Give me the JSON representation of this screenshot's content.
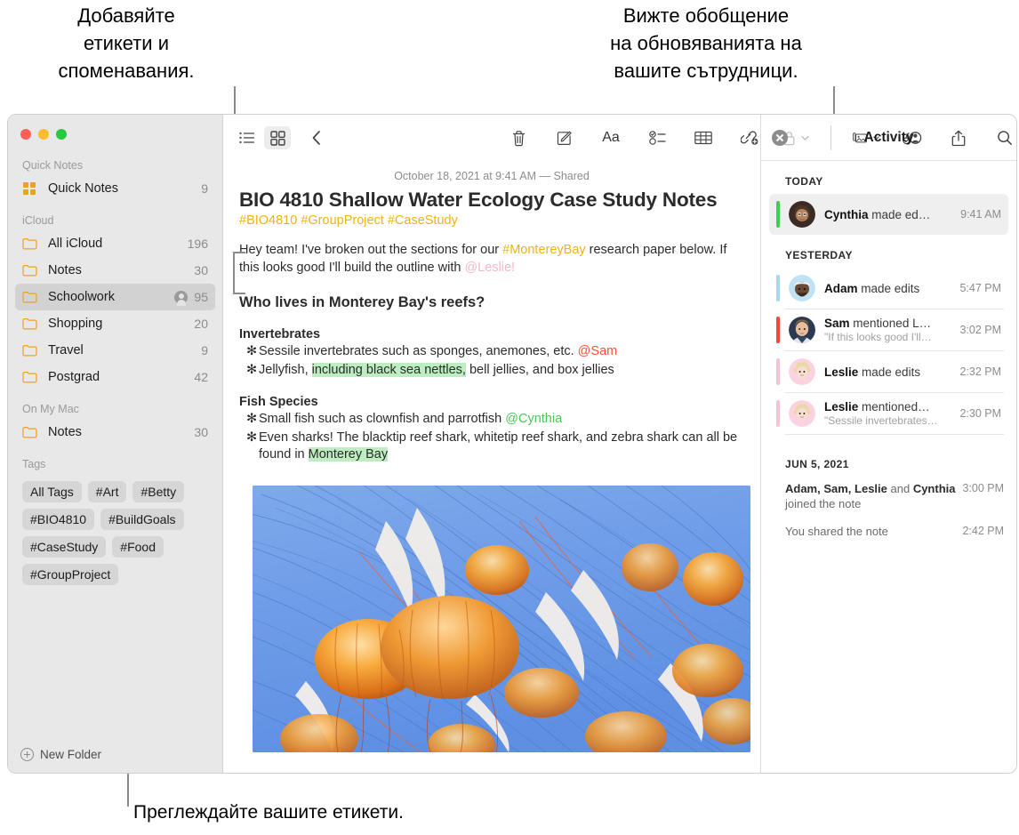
{
  "callouts": {
    "left": "Добавяйте\nетикети и\nспоменавания.",
    "right": "Вижте обобщение\nна обновяванията на\nвашите сътрудници.",
    "bottom": "Преглеждайте вашите етикети."
  },
  "window": {
    "traffic_lights": [
      "close",
      "minimize",
      "zoom"
    ]
  },
  "sidebar": {
    "groups": [
      {
        "title": "Quick Notes",
        "rows": [
          {
            "icon": "quicknotes-icon",
            "label": "Quick Notes",
            "count": "9",
            "shared": false,
            "selected": false
          }
        ]
      },
      {
        "title": "iCloud",
        "rows": [
          {
            "icon": "folder-icon",
            "label": "All iCloud",
            "count": "196",
            "shared": false,
            "selected": false
          },
          {
            "icon": "folder-icon",
            "label": "Notes",
            "count": "30",
            "shared": false,
            "selected": false
          },
          {
            "icon": "folder-icon",
            "label": "Schoolwork",
            "count": "95",
            "shared": true,
            "selected": true
          },
          {
            "icon": "folder-icon",
            "label": "Shopping",
            "count": "20",
            "shared": false,
            "selected": false
          },
          {
            "icon": "folder-icon",
            "label": "Travel",
            "count": "9",
            "shared": false,
            "selected": false
          },
          {
            "icon": "folder-icon",
            "label": "Postgrad",
            "count": "42",
            "shared": false,
            "selected": false
          }
        ]
      },
      {
        "title": "On My Mac",
        "rows": [
          {
            "icon": "folder-icon",
            "label": "Notes",
            "count": "30",
            "shared": false,
            "selected": false
          }
        ]
      }
    ],
    "tags_title": "Tags",
    "tags": [
      "All Tags",
      "#Art",
      "#Betty",
      "#BIO4810",
      "#BuildGoals",
      "#CaseStudy",
      "#Food",
      "#GroupProject"
    ],
    "new_folder_label": "New Folder"
  },
  "toolbar": {
    "buttons": [
      {
        "name": "list-view-icon",
        "label": "List View"
      },
      {
        "name": "gallery-view-icon",
        "label": "Gallery View"
      },
      {
        "name": "back-chevron-icon",
        "label": "Back"
      },
      {
        "name": "trash-icon",
        "label": "Delete"
      },
      {
        "name": "compose-icon",
        "label": "New Note"
      },
      {
        "name": "format-icon",
        "label": "Aa"
      },
      {
        "name": "checklist-icon",
        "label": "Checklist"
      },
      {
        "name": "table-icon",
        "label": "Table"
      },
      {
        "name": "link-icon",
        "label": "Add Link"
      },
      {
        "name": "lock-icon",
        "label": "Lock"
      },
      {
        "name": "media-icon",
        "label": "Media"
      },
      {
        "name": "collaborate-icon",
        "label": "Collaborate"
      },
      {
        "name": "share-icon",
        "label": "Share"
      },
      {
        "name": "search-icon",
        "label": "Search"
      }
    ]
  },
  "note": {
    "date": "October 18, 2021 at 9:41 AM — Shared",
    "title": "BIO 4810 Shallow Water Ecology Case Study Notes",
    "tags_line": "#BIO4810 #GroupProject #CaseStudy",
    "intro": {
      "part1": "Hey team! I've broken out the sections for our ",
      "tag": "#MontereyBay",
      "part2": " research paper below. If this looks good I'll build the outline with ",
      "mention": "@Leslie!"
    },
    "heading": "Who lives in Monterey Bay's reefs?",
    "sections": [
      {
        "subheading": "Invertebrates",
        "bullets": [
          {
            "marker": "✻",
            "pre": "Sessile invertebrates such as sponges, anemones, etc. ",
            "mention": "@Sam",
            "mention_color": "red",
            "post": "",
            "hi_pre": "",
            "hi": "",
            "hi_post": ""
          },
          {
            "marker": "✻",
            "pre": "Jellyfish, ",
            "mention": "",
            "mention_color": "",
            "post": " bell jellies, and box jellies",
            "hi_pre": "",
            "hi": "including black sea nettles,",
            "hi_post": ""
          }
        ]
      },
      {
        "subheading": "Fish Species",
        "bullets": [
          {
            "marker": "✻",
            "pre": "Small fish such as clownfish and parrotfish ",
            "mention": "@Cynthia",
            "mention_color": "green",
            "post": "",
            "hi_pre": "",
            "hi": "",
            "hi_post": ""
          },
          {
            "marker": "✻",
            "pre": "Even sharks! The blacktip reef shark, whitetip reef shark, and zebra shark can all be found in ",
            "mention": "",
            "mention_color": "",
            "post": "",
            "hi_pre": "",
            "hi": "Monterey Bay",
            "hi_post": ""
          }
        ]
      }
    ],
    "image_alt": "jellyfish-photo"
  },
  "activity": {
    "title": "Activity",
    "groups": [
      {
        "label": "TODAY",
        "items": [
          {
            "bar_color": "#3bd14a",
            "avatar": "#c19377",
            "name": "Cynthia",
            "action": " made ed…",
            "quote": "",
            "time": "9:41 AM",
            "highlight": true
          }
        ]
      },
      {
        "label": "YESTERDAY",
        "items": [
          {
            "bar_color": "#a8d8f0",
            "avatar": "#a8d8f0",
            "name": "Adam",
            "action": " made edits",
            "quote": "",
            "time": "5:47 PM",
            "highlight": false
          },
          {
            "bar_color": "#f04a33",
            "avatar": "#e4b79a",
            "name": "Sam",
            "action": " mentioned L…",
            "quote": "\"If this looks good I'll…",
            "time": "3:02 PM",
            "highlight": false
          },
          {
            "bar_color": "#f8c3d4",
            "avatar": "#f8c3d4",
            "name": "Leslie",
            "action": " made edits",
            "quote": "",
            "time": "2:32 PM",
            "highlight": false
          },
          {
            "bar_color": "#f8c3d4",
            "avatar": "#f8c3d4",
            "name": "Leslie",
            "action": " mentioned…",
            "quote": "\"Sessile invertebrates…",
            "time": "2:30 PM",
            "highlight": false
          }
        ]
      }
    ],
    "old_group": {
      "label": "JUN 5, 2021",
      "rows": [
        {
          "names": "Adam, Sam, Leslie",
          "mid": " and ",
          "names2": "Cynthia",
          "tail": " joined the note",
          "time": "3:00 PM"
        },
        {
          "names": "",
          "mid": "",
          "names2": "",
          "tail": "You shared the note",
          "time": "2:42 PM"
        }
      ]
    }
  },
  "colors": {
    "accent_orange": "#efb316",
    "highlight_green": "#bdeec2",
    "sidebar_bg": "#e8e8e8",
    "selected_row": "#d2d2d2"
  }
}
